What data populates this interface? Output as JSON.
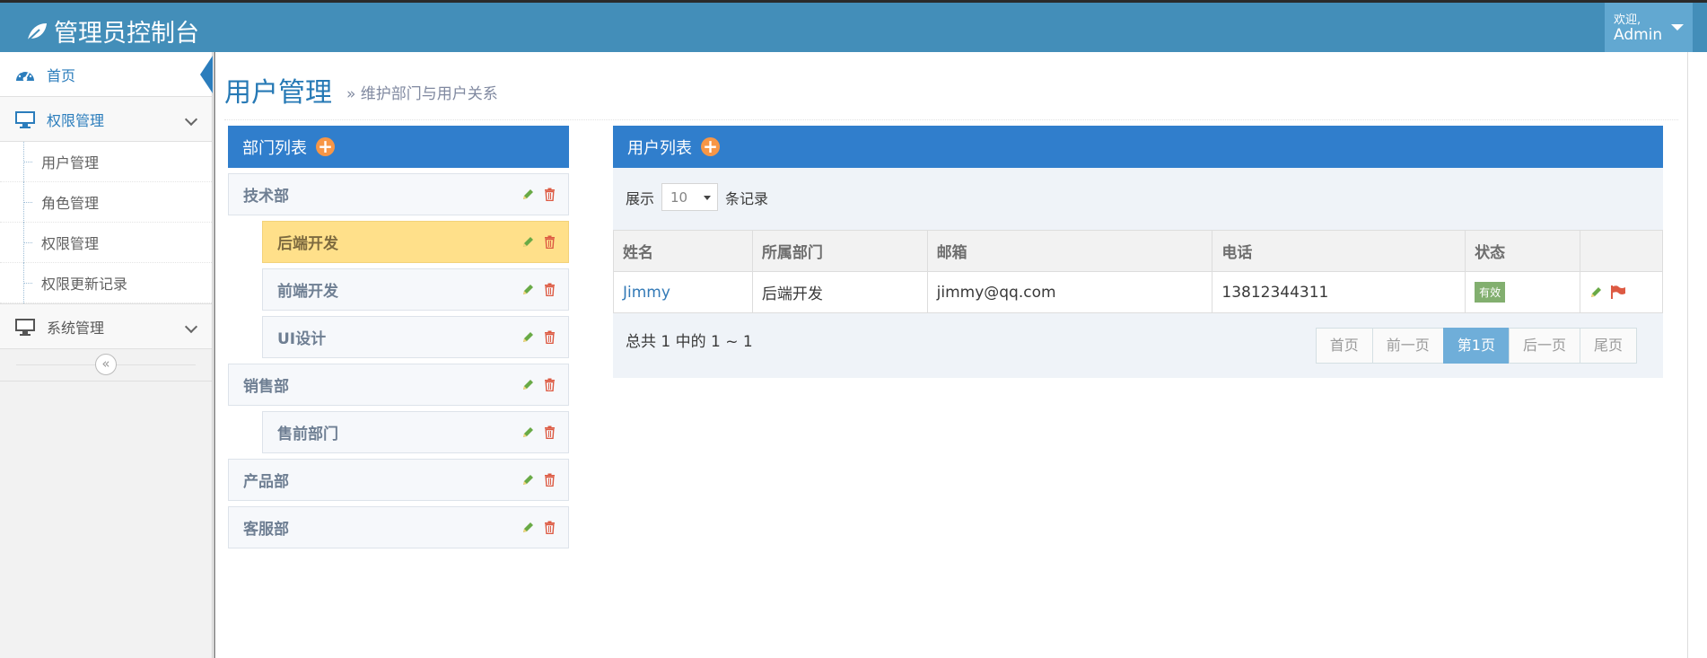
{
  "navbar": {
    "brand_title": "管理员控制台",
    "welcome_label": "欢迎,",
    "user_name": "Admin"
  },
  "sidebar": {
    "items": [
      {
        "label": "首页",
        "icon": "dashboard-icon"
      },
      {
        "label": "权限管理",
        "icon": "desktop-icon"
      },
      {
        "label": "系统管理",
        "icon": "desktop-icon"
      }
    ],
    "sub_items": [
      "用户管理",
      "角色管理",
      "权限管理",
      "权限更新记录"
    ],
    "collapse_glyph": "«"
  },
  "page": {
    "title": "用户管理",
    "subtitle": "» 维护部门与用户关系"
  },
  "dept_panel": {
    "title": "部门列表",
    "departments": [
      {
        "name": "技术部",
        "level": 0,
        "selected": false
      },
      {
        "name": "后端开发",
        "level": 1,
        "selected": true
      },
      {
        "name": "前端开发",
        "level": 1,
        "selected": false
      },
      {
        "name": "UI设计",
        "level": 1,
        "selected": false
      },
      {
        "name": "销售部",
        "level": 0,
        "selected": false
      },
      {
        "name": "售前部门",
        "level": 1,
        "selected": false
      },
      {
        "name": "产品部",
        "level": 0,
        "selected": false
      },
      {
        "name": "客服部",
        "level": 0,
        "selected": false
      }
    ]
  },
  "user_panel": {
    "title": "用户列表",
    "length_prefix": "展示",
    "length_value": "10",
    "length_suffix": "条记录",
    "columns": [
      "姓名",
      "所属部门",
      "邮箱",
      "电话",
      "状态",
      ""
    ],
    "rows": [
      {
        "name": "Jimmy",
        "dept": "后端开发",
        "email": "jimmy@qq.com",
        "phone": "13812344311",
        "status": "有效"
      }
    ],
    "info": "总共 1 中的 1 ~ 1",
    "pager": [
      "首页",
      "前一页",
      "第1页",
      "后一页",
      "尾页"
    ],
    "current_page_index": 2
  },
  "colors": {
    "navbar": "#438eb9",
    "panel_header": "#307ecc",
    "selected_dept": "#ffe08a",
    "status_badge": "#82af6f",
    "plus_icon": "#f79646",
    "active_page": "#6faed9"
  }
}
